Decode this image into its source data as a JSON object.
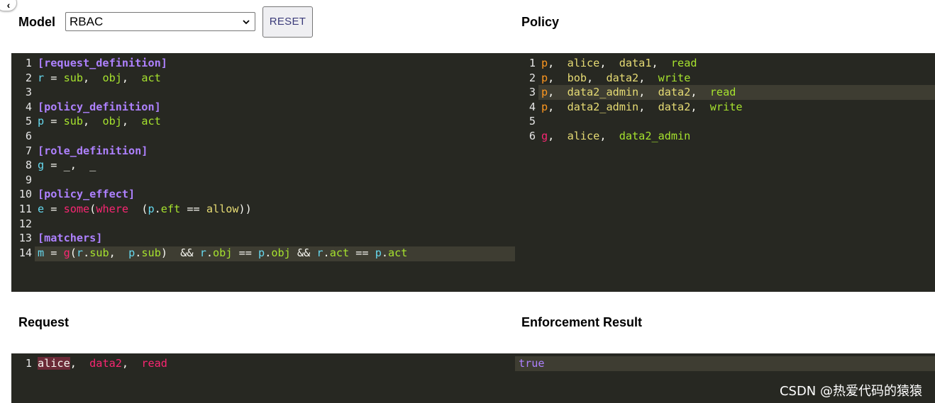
{
  "nav": {
    "back_icon": "chevron-left-icon"
  },
  "model": {
    "label": "Model",
    "selected": "RBAC",
    "reset_label": "RESET",
    "lines": [
      [
        [
          "[request_definition]",
          "sec"
        ]
      ],
      [
        [
          "r",
          "var"
        ],
        [
          " = ",
          "op"
        ],
        [
          "sub",
          "val"
        ],
        [
          ",  ",
          "op"
        ],
        [
          "obj",
          "val"
        ],
        [
          ",  ",
          "op"
        ],
        [
          "act",
          "val"
        ]
      ],
      [],
      [
        [
          "[policy_definition]",
          "sec"
        ]
      ],
      [
        [
          "p",
          "var"
        ],
        [
          " = ",
          "op"
        ],
        [
          "sub",
          "val"
        ],
        [
          ",  ",
          "op"
        ],
        [
          "obj",
          "val"
        ],
        [
          ",  ",
          "op"
        ],
        [
          "act",
          "val"
        ]
      ],
      [],
      [
        [
          "[role_definition]",
          "sec"
        ]
      ],
      [
        [
          "g",
          "var"
        ],
        [
          " = ",
          "op"
        ],
        [
          "_,  _",
          "op"
        ]
      ],
      [],
      [
        [
          "[policy_effect]",
          "sec"
        ]
      ],
      [
        [
          "e",
          "var"
        ],
        [
          " = ",
          "op"
        ],
        [
          "some",
          "fn"
        ],
        [
          "(",
          "op"
        ],
        [
          "where",
          "kw"
        ],
        [
          "  (",
          "op"
        ],
        [
          "p",
          "var"
        ],
        [
          ".",
          "op"
        ],
        [
          "eft",
          "fld"
        ],
        [
          " == ",
          "op"
        ],
        [
          "allow",
          "str"
        ],
        [
          "))",
          "op"
        ]
      ],
      [],
      [
        [
          "[matchers]",
          "sec"
        ]
      ],
      [
        [
          "m",
          "var"
        ],
        [
          " = ",
          "op"
        ],
        [
          "g",
          "fn"
        ],
        [
          "(",
          "op"
        ],
        [
          "r",
          "var"
        ],
        [
          ".",
          "op"
        ],
        [
          "sub",
          "fld"
        ],
        [
          ",  ",
          "op"
        ],
        [
          "p",
          "var"
        ],
        [
          ".",
          "op"
        ],
        [
          "sub",
          "fld"
        ],
        [
          ")  && ",
          "op"
        ],
        [
          "r",
          "var"
        ],
        [
          ".",
          "op"
        ],
        [
          "obj",
          "fld"
        ],
        [
          " == ",
          "op"
        ],
        [
          "p",
          "var"
        ],
        [
          ".",
          "op"
        ],
        [
          "obj",
          "fld"
        ],
        [
          " && ",
          "op"
        ],
        [
          "r",
          "var"
        ],
        [
          ".",
          "op"
        ],
        [
          "act",
          "fld"
        ],
        [
          " == ",
          "op"
        ],
        [
          "p",
          "var"
        ],
        [
          ".",
          "op"
        ],
        [
          "act",
          "fld"
        ]
      ]
    ]
  },
  "policy": {
    "label": "Policy",
    "lines": [
      [
        [
          "p",
          "ptype"
        ],
        [
          ",  ",
          "op"
        ],
        [
          "alice",
          "str"
        ],
        [
          ",  ",
          "op"
        ],
        [
          "data1",
          "str"
        ],
        [
          ",  ",
          "op"
        ],
        [
          "read",
          "val"
        ]
      ],
      [
        [
          "p",
          "ptype"
        ],
        [
          ",  ",
          "op"
        ],
        [
          "bob",
          "str"
        ],
        [
          ",  ",
          "op"
        ],
        [
          "data2",
          "str"
        ],
        [
          ",  ",
          "op"
        ],
        [
          "write",
          "val"
        ]
      ],
      [
        [
          "p",
          "ptype"
        ],
        [
          ",  ",
          "op"
        ],
        [
          "data2_admin",
          "str"
        ],
        [
          ",  ",
          "op"
        ],
        [
          "data2",
          "str"
        ],
        [
          ",  ",
          "op"
        ],
        [
          "read",
          "val"
        ]
      ],
      [
        [
          "p",
          "ptype"
        ],
        [
          ",  ",
          "op"
        ],
        [
          "data2_admin",
          "str"
        ],
        [
          ",  ",
          "op"
        ],
        [
          "data2",
          "str"
        ],
        [
          ",  ",
          "op"
        ],
        [
          "write",
          "val"
        ]
      ],
      [],
      [
        [
          "g",
          "red"
        ],
        [
          ",  ",
          "op"
        ],
        [
          "alice",
          "str"
        ],
        [
          ",  ",
          "op"
        ],
        [
          "data2_admin",
          "val"
        ]
      ]
    ]
  },
  "request": {
    "label": "Request",
    "lines": [
      [
        [
          "alice",
          "hl"
        ],
        [
          ",  ",
          "op"
        ],
        [
          "data2",
          "red"
        ],
        [
          ",  ",
          "op"
        ],
        [
          "read",
          "red"
        ]
      ]
    ]
  },
  "result": {
    "label": "Enforcement Result",
    "value": "true"
  },
  "watermark": "CSDN @热爱代码的猿猿",
  "colors": {
    "editor_bg": "#272822",
    "active_line": "#3e3d32",
    "keyword": "#f92672",
    "section": "#ae81ff"
  }
}
